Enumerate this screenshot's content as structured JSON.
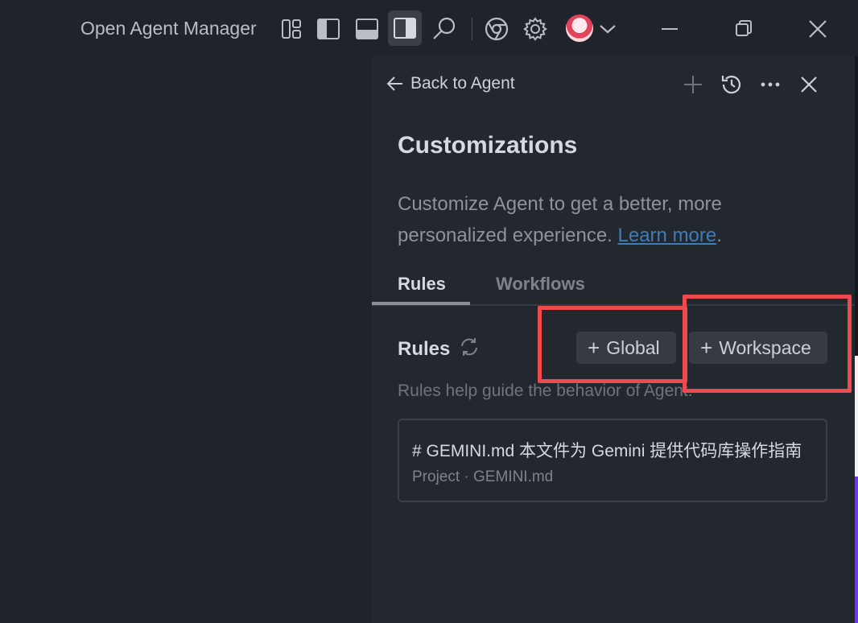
{
  "app": {
    "title": "Open Agent Manager"
  },
  "titlebar": {
    "icons": [
      "layout-icon",
      "sidebar-left-icon",
      "panel-bottom-icon",
      "sidebar-right-icon",
      "search-icon",
      "chrome-icon",
      "gear-icon",
      "avatar",
      "chevron-down-icon"
    ],
    "window_controls": [
      "minimize-icon",
      "restore-icon",
      "close-icon"
    ]
  },
  "panel": {
    "back_label": "Back to Agent",
    "header_icons": [
      "plus-icon",
      "history-icon",
      "more-icon",
      "close-icon"
    ],
    "heading": "Customizations",
    "description": "Customize Agent to get a better, more personalized experience.",
    "learn_more": "Learn more",
    "period": ".",
    "tabs": [
      {
        "label": "Rules",
        "active": true
      },
      {
        "label": "Workflows",
        "active": false
      }
    ],
    "rules_section": {
      "title": "Rules",
      "global_button": "Global",
      "workspace_button": "Workspace",
      "help_text": "Rules help guide the behavior of Agent.",
      "items": [
        {
          "title": "# GEMINI.md 本文件为 Gemini 提供代码库操作指南",
          "subtitle": "Project · GEMINI.md"
        }
      ]
    }
  },
  "colors": {
    "background": "#1f232a",
    "panel": "#23272e",
    "link": "#3f7cb8",
    "highlight": "#ef4b4f",
    "chip": "#363a42"
  }
}
